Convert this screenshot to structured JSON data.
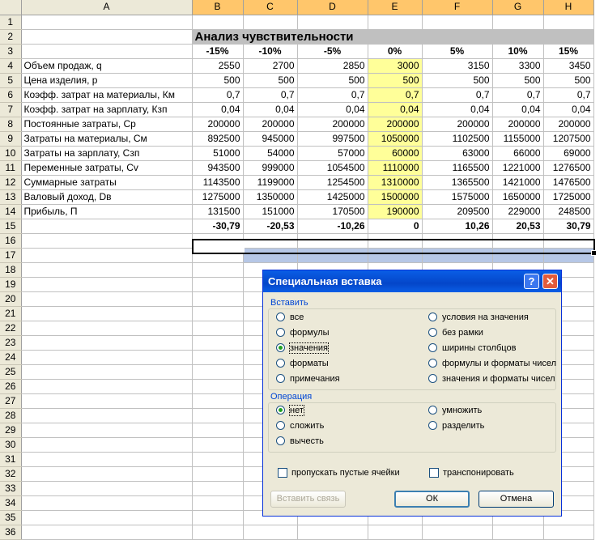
{
  "columns": [
    "A",
    "B",
    "C",
    "D",
    "E",
    "F",
    "G",
    "H"
  ],
  "rows": [
    {
      "n": "1",
      "cells": [
        "",
        "",
        "",
        "",
        "",
        "",
        "",
        ""
      ]
    },
    {
      "n": "2",
      "cells": [
        "",
        "Анализ чувствительности",
        "",
        "",
        "",
        "",
        "",
        ""
      ]
    },
    {
      "n": "3",
      "cells": [
        "",
        "-15%",
        "-10%",
        "-5%",
        "0%",
        "5%",
        "10%",
        "15%"
      ]
    },
    {
      "n": "4",
      "cells": [
        "Объем продаж, q",
        "2550",
        "2700",
        "2850",
        "3000",
        "3150",
        "3300",
        "3450"
      ]
    },
    {
      "n": "5",
      "cells": [
        "Цена изделия, p",
        "500",
        "500",
        "500",
        "500",
        "500",
        "500",
        "500"
      ]
    },
    {
      "n": "6",
      "cells": [
        "Коэфф. затрат на материалы, Км",
        "0,7",
        "0,7",
        "0,7",
        "0,7",
        "0,7",
        "0,7",
        "0,7"
      ]
    },
    {
      "n": "7",
      "cells": [
        "Коэфф. затрат на зарплату, Кзп",
        "0,04",
        "0,04",
        "0,04",
        "0,04",
        "0,04",
        "0,04",
        "0,04"
      ]
    },
    {
      "n": "8",
      "cells": [
        "Постоянные затраты, Cp",
        "200000",
        "200000",
        "200000",
        "200000",
        "200000",
        "200000",
        "200000"
      ]
    },
    {
      "n": "9",
      "cells": [
        "Затраты на материалы, См",
        "892500",
        "945000",
        "997500",
        "1050000",
        "1102500",
        "1155000",
        "1207500"
      ]
    },
    {
      "n": "10",
      "cells": [
        "Затраты на зарплату, Сзп",
        "51000",
        "54000",
        "57000",
        "60000",
        "63000",
        "66000",
        "69000"
      ]
    },
    {
      "n": "11",
      "cells": [
        "Переменные затраты, Cv",
        "943500",
        "999000",
        "1054500",
        "1110000",
        "1165500",
        "1221000",
        "1276500"
      ]
    },
    {
      "n": "12",
      "cells": [
        "Суммарные затраты",
        "1143500",
        "1199000",
        "1254500",
        "1310000",
        "1365500",
        "1421000",
        "1476500"
      ]
    },
    {
      "n": "13",
      "cells": [
        "Валовый доход, Dв",
        "1275000",
        "1350000",
        "1425000",
        "1500000",
        "1575000",
        "1650000",
        "1725000"
      ]
    },
    {
      "n": "14",
      "cells": [
        "Прибыль, П",
        "131500",
        "151000",
        "170500",
        "190000",
        "209500",
        "229000",
        "248500"
      ]
    },
    {
      "n": "15",
      "cells": [
        "",
        "-30,79",
        "-20,53",
        "-10,26",
        "0",
        "10,26",
        "20,53",
        "30,79"
      ]
    },
    {
      "n": "16",
      "cells": [
        "",
        "",
        "",
        "",
        "",
        "",
        "",
        ""
      ]
    },
    {
      "n": "17",
      "cells": [
        "",
        "",
        "",
        "",
        "",
        "",
        "",
        ""
      ]
    },
    {
      "n": "18",
      "cells": [
        "",
        "",
        "",
        "",
        "",
        "",
        "",
        ""
      ]
    },
    {
      "n": "19",
      "cells": [
        "",
        "",
        "",
        "",
        "",
        "",
        "",
        ""
      ]
    },
    {
      "n": "20",
      "cells": [
        "",
        "",
        "",
        "",
        "",
        "",
        "",
        ""
      ]
    },
    {
      "n": "21",
      "cells": [
        "",
        "",
        "",
        "",
        "",
        "",
        "",
        ""
      ]
    },
    {
      "n": "22",
      "cells": [
        "",
        "",
        "",
        "",
        "",
        "",
        "",
        ""
      ]
    },
    {
      "n": "23",
      "cells": [
        "",
        "",
        "",
        "",
        "",
        "",
        "",
        ""
      ]
    },
    {
      "n": "24",
      "cells": [
        "",
        "",
        "",
        "",
        "",
        "",
        "",
        ""
      ]
    },
    {
      "n": "25",
      "cells": [
        "",
        "",
        "",
        "",
        "",
        "",
        "",
        ""
      ]
    },
    {
      "n": "26",
      "cells": [
        "",
        "",
        "",
        "",
        "",
        "",
        "",
        ""
      ]
    },
    {
      "n": "27",
      "cells": [
        "",
        "",
        "",
        "",
        "",
        "",
        "",
        ""
      ]
    },
    {
      "n": "28",
      "cells": [
        "",
        "",
        "",
        "",
        "",
        "",
        "",
        ""
      ]
    },
    {
      "n": "29",
      "cells": [
        "",
        "",
        "",
        "",
        "",
        "",
        "",
        ""
      ]
    },
    {
      "n": "30",
      "cells": [
        "",
        "",
        "",
        "",
        "",
        "",
        "",
        ""
      ]
    },
    {
      "n": "31",
      "cells": [
        "",
        "",
        "",
        "",
        "",
        "",
        "",
        ""
      ]
    },
    {
      "n": "32",
      "cells": [
        "",
        "",
        "",
        "",
        "",
        "",
        "",
        ""
      ]
    },
    {
      "n": "33",
      "cells": [
        "",
        "",
        "",
        "",
        "",
        "",
        "",
        ""
      ]
    },
    {
      "n": "34",
      "cells": [
        "",
        "",
        "",
        "",
        "",
        "",
        "",
        ""
      ]
    },
    {
      "n": "35",
      "cells": [
        "",
        "",
        "",
        "",
        "",
        "",
        "",
        ""
      ]
    },
    {
      "n": "36",
      "cells": [
        "",
        "",
        "",
        "",
        "",
        "",
        "",
        ""
      ]
    }
  ],
  "dialog": {
    "title": "Специальная вставка",
    "help_label": "?",
    "close_label": "✕",
    "paste_group": "Вставить",
    "paste_left": [
      "все",
      "формулы",
      "значения",
      "форматы",
      "примечания"
    ],
    "paste_right": [
      "условия на значения",
      "без рамки",
      "ширины столбцов",
      "формулы и форматы чисел",
      "значения и форматы чисел"
    ],
    "paste_selected": "значения",
    "op_group": "Операция",
    "op_left": [
      "нет",
      "сложить",
      "вычесть"
    ],
    "op_right": [
      "умножить",
      "разделить"
    ],
    "op_selected": "нет",
    "skip_blanks": "пропускать пустые ячейки",
    "transpose": "транспонировать",
    "paste_link": "Вставить связь",
    "ok": "ОК",
    "cancel": "Отмена"
  },
  "colors": {
    "highlight": "#ffff99",
    "title_bg": "#c0c0c0",
    "header_bg": "#ece9d8",
    "selected_col_header": "#ffc66b",
    "dialog_title": "#0446c9"
  }
}
